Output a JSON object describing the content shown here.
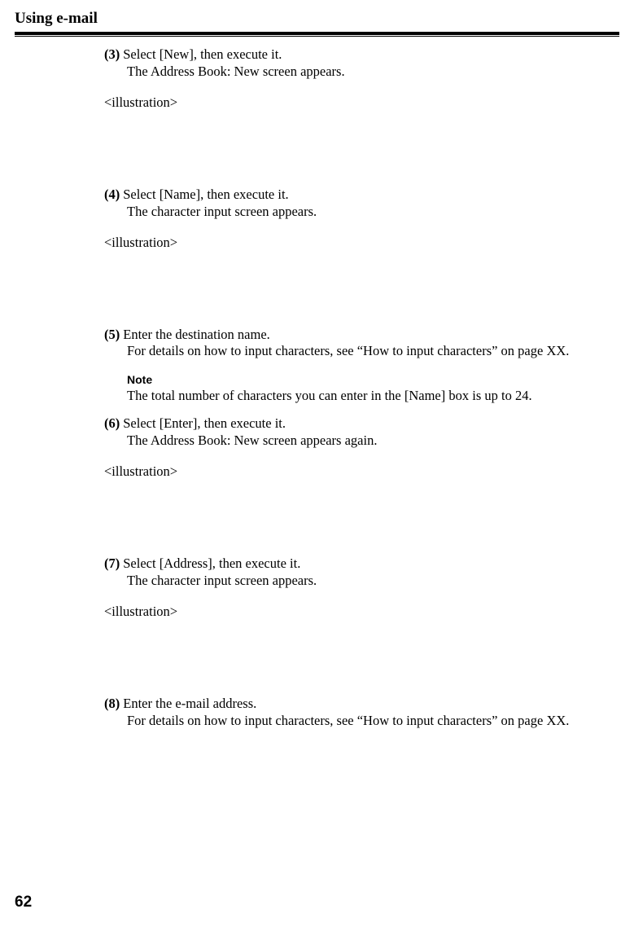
{
  "header": {
    "title": "Using e-mail"
  },
  "steps": {
    "s3": {
      "num": "3",
      "line1": "Select [New], then execute it.",
      "line2": "The Address Book: New screen appears.",
      "illus": "<illustration>"
    },
    "s4": {
      "num": "4",
      "line1": "Select [Name], then execute it.",
      "line2": "The character input screen appears.",
      "illus": "<illustration>"
    },
    "s5": {
      "num": "5",
      "line1": "Enter the destination name.",
      "line2": "For details on how to input characters, see “How to input characters” on page XX.",
      "noteLabel": "Note",
      "noteText": "The total number of characters you can enter in the [Name] box is up to 24."
    },
    "s6": {
      "num": "6",
      "line1": "Select [Enter], then execute it.",
      "line2": "The Address Book: New screen appears again.",
      "illus": "<illustration>"
    },
    "s7": {
      "num": "7",
      "line1": "Select [Address], then execute it.",
      "line2": "The character input screen appears.",
      "illus": "<illustration>"
    },
    "s8": {
      "num": "8",
      "line1": "Enter the e-mail address.",
      "line2": "For details on how to input characters, see “How to input characters” on page XX."
    }
  },
  "pageNumber": "62"
}
